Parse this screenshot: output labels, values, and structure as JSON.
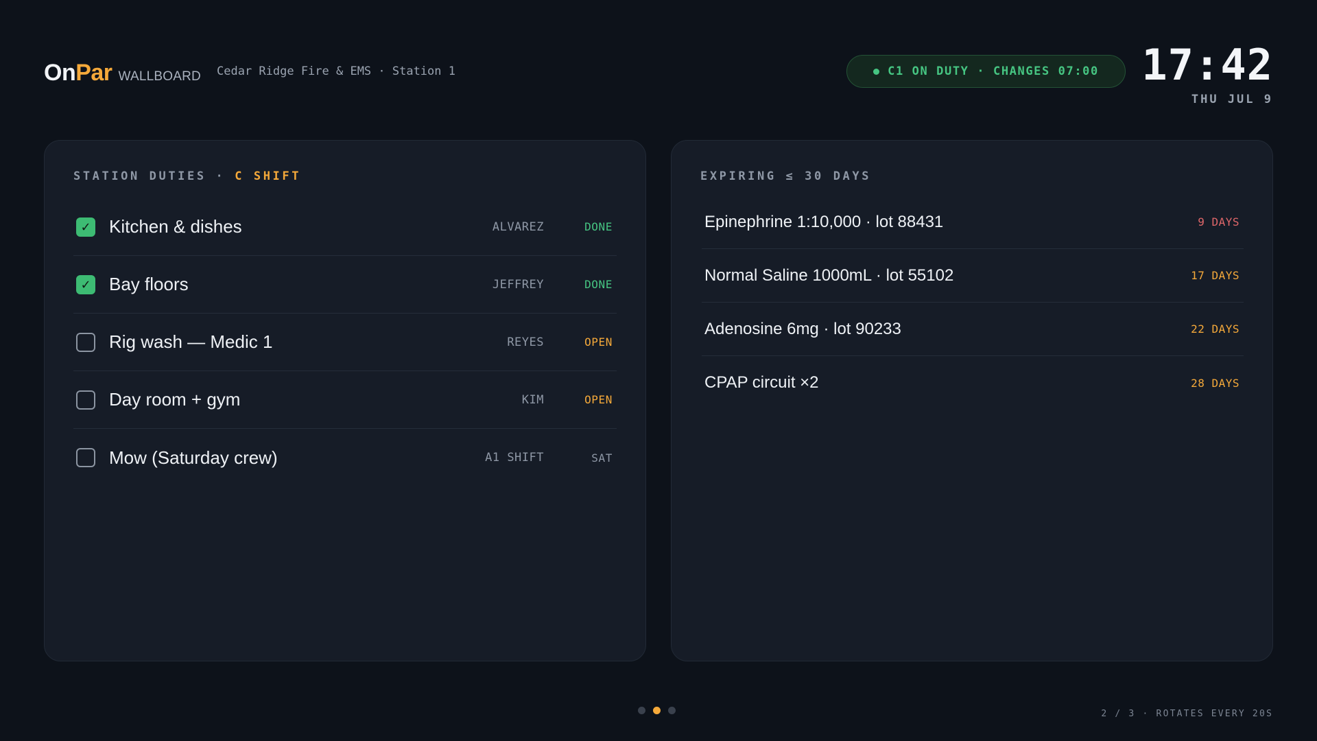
{
  "header": {
    "brand_on": "On",
    "brand_par": "Par",
    "brand_wallboard": "WALLBOARD",
    "station": "Cedar Ridge Fire & EMS · Station 1",
    "duty_status": "C1 ON DUTY · CHANGES 07:00",
    "clock_time": "17:42",
    "clock_date": "THU JUL 9"
  },
  "duties": {
    "title_prefix": "STATION DUTIES · ",
    "title_accent": "C SHIFT",
    "items": [
      {
        "label": "Kitchen & dishes",
        "assignee": "ALVAREZ",
        "status": "DONE",
        "checked": true
      },
      {
        "label": "Bay floors",
        "assignee": "JEFFREY",
        "status": "DONE",
        "checked": true
      },
      {
        "label": "Rig wash — Medic 1",
        "assignee": "REYES",
        "status": "OPEN",
        "checked": false
      },
      {
        "label": "Day room + gym",
        "assignee": "KIM",
        "status": "OPEN",
        "checked": false
      },
      {
        "label": "Mow (Saturday crew)",
        "assignee": "A1 SHIFT",
        "status": "SAT",
        "checked": false
      }
    ]
  },
  "expiring": {
    "title": "EXPIRING ≤ 30 DAYS",
    "items": [
      {
        "label": "Epinephrine 1:10,000 · lot 88431",
        "days": "9 DAYS",
        "color": "#e0676a"
      },
      {
        "label": "Normal Saline 1000mL · lot 55102",
        "days": "17 DAYS",
        "color": "#f5a93a"
      },
      {
        "label": "Adenosine 6mg · lot 90233",
        "days": "22 DAYS",
        "color": "#f5a93a"
      },
      {
        "label": "CPAP circuit ×2",
        "days": "28 DAYS",
        "color": "#f5a93a"
      }
    ]
  },
  "footer": {
    "pages_total": 3,
    "current_page": 2,
    "rotate_note": "2 / 3 · ROTATES EVERY 20S"
  },
  "colors": {
    "background": "#0d121a",
    "panel": "#161c27",
    "accent": "#f5a93a",
    "success": "#46c582",
    "danger": "#e0676a"
  }
}
